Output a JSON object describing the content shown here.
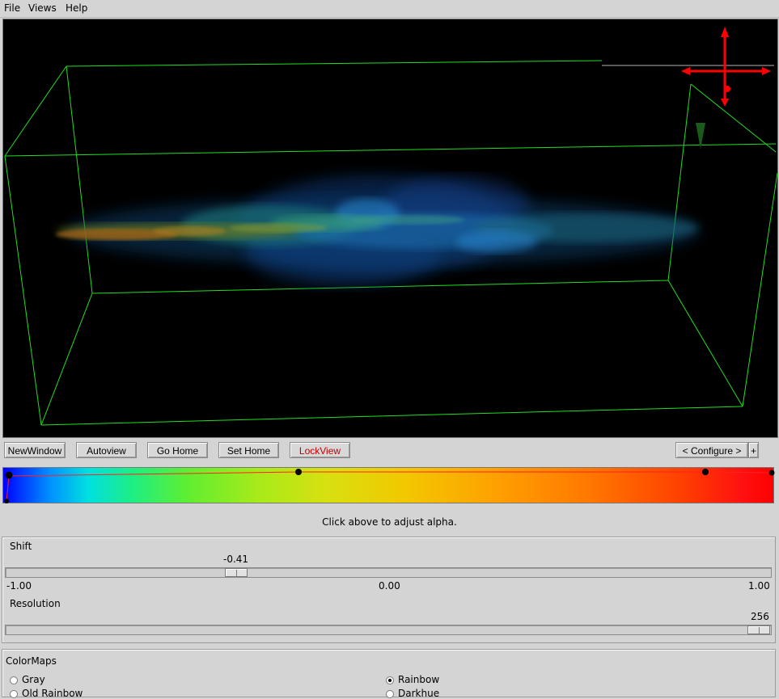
{
  "menu": {
    "file": "File",
    "views": "Views",
    "help": "Help"
  },
  "toolbar": {
    "new_window": "NewWindow",
    "autoview": "Autoview",
    "go_home": "Go Home",
    "set_home": "Set Home",
    "lock_view": "LockView",
    "configure": "< Configure >",
    "plus": "+"
  },
  "colormap": {
    "hint": "Click above to adjust alpha.",
    "colors": {
      "bounding_box": "#22dd22",
      "alpha_line": "#ff2020",
      "axes": "#ff0000"
    }
  },
  "shift": {
    "label": "Shift",
    "value": "-0.41",
    "min": "-1.00",
    "mid": "0.00",
    "max": "1.00",
    "fraction": 0.295
  },
  "resolution": {
    "label": "Resolution",
    "value": "256",
    "fraction": 1.0
  },
  "colormaps": {
    "title": "ColorMaps",
    "options": [
      {
        "label": "Gray",
        "selected": false
      },
      {
        "label": "Rainbow",
        "selected": true
      },
      {
        "label": "Old Rainbow",
        "selected": false
      },
      {
        "label": "Darkhue",
        "selected": false
      }
    ]
  }
}
